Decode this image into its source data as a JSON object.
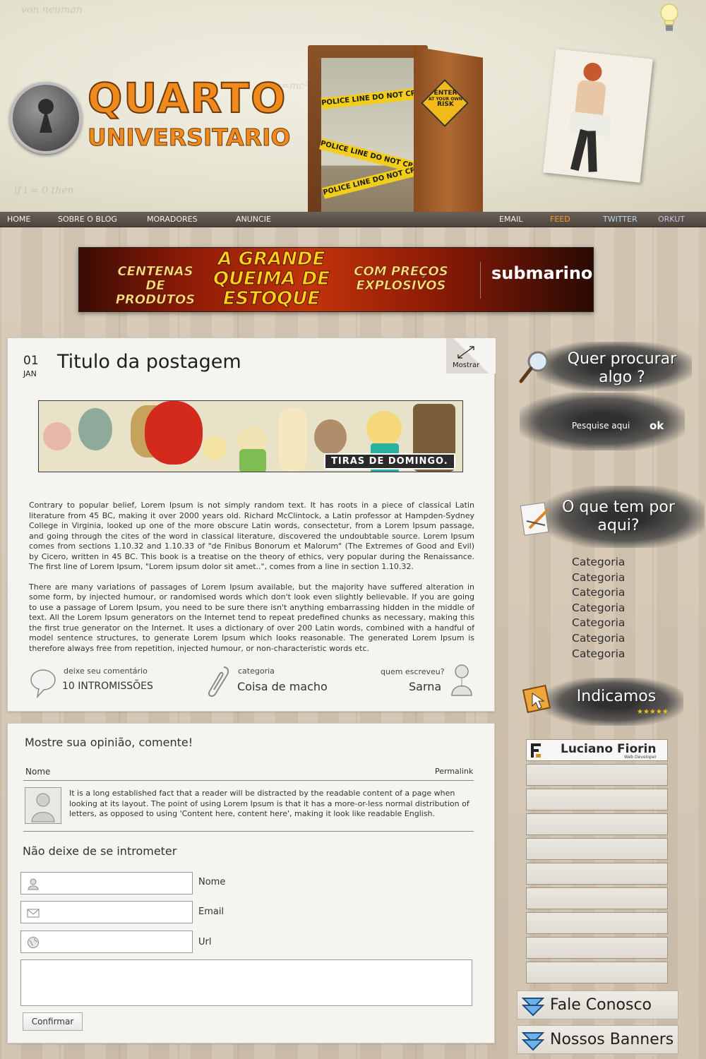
{
  "header": {
    "logo_title": "QUARTO",
    "logo_subtitle": "UNIVERSITARIO",
    "door_sign": [
      "ENTER",
      "AT YOUR OWN",
      "RISK"
    ],
    "tape_text": "POLICE LINE DO NOT CROSS"
  },
  "nav": {
    "left": [
      "HOME",
      "SOBRE O BLOG",
      "MORADORES",
      "ANUNCIE"
    ],
    "right": [
      {
        "label": "EMAIL",
        "color": "#f4f1ea"
      },
      {
        "label": "FEED",
        "color": "#f39a2a"
      },
      {
        "label": "TWITTER",
        "color": "#bcd7ee"
      },
      {
        "label": "ORKUT",
        "color": "#d7b6e6"
      }
    ]
  },
  "banner": {
    "left": "CENTENAS DE PRODUTOS",
    "center": "A GRANDE QUEIMA DE ESTOQUE",
    "right": "COM PREÇOS EXPLOSIVOS",
    "brand": "submarino"
  },
  "post": {
    "day": "01",
    "month": "JAN",
    "title": "Titulo da postagem",
    "toggle_label": "Mostrar",
    "comic_caption": "TIRAS DE DOMINGO.",
    "paragraphs": [
      "Contrary to popular belief, Lorem Ipsum is not simply random text. It has roots in a piece of classical Latin literature from 45 BC, making it over 2000 years old. Richard McClintock, a Latin professor at Hampden-Sydney College in Virginia, looked up one of the more obscure Latin words, consectetur, from a Lorem Ipsum passage, and going through the cites of the word in classical literature, discovered the undoubtable source. Lorem Ipsum comes from sections 1.10.32 and 1.10.33 of \"de Finibus Bonorum et Malorum\" (The Extremes of Good and Evil) by Cicero, written in 45 BC. This book is a treatise on the theory of ethics, very popular during the Renaissance. The first line of Lorem Ipsum, \"Lorem ipsum dolor sit amet..\", comes from a line in section 1.10.32.",
      "There are many variations of passages of Lorem Ipsum available, but the majority have suffered alteration in some form, by injected humour, or randomised words which don't look even slightly believable. If you are going to use a passage of Lorem Ipsum, you need to be sure there isn't anything embarrassing hidden in the middle of text. All the Lorem Ipsum generators on the Internet tend to repeat predefined chunks as necessary, making this the first true generator on the Internet. It uses a dictionary of over 200 Latin words, combined with a handful of model sentence structures, to generate Lorem Ipsum which looks reasonable. The generated Lorem Ipsum is therefore always free from repetition, injected humour, or non-characteristic words etc."
    ],
    "meta": {
      "comment_label": "deixe seu comentário",
      "comment_value": "10 INTROMISSÕES",
      "category_label": "categoria",
      "category_value": "Coisa de macho",
      "author_label": "quem escreveu?",
      "author_value": "Sarna"
    }
  },
  "comments": {
    "heading": "Mostre sua opinião, comente!",
    "name_header": "Nome",
    "permalink": "Permalink",
    "sample_comment": "It is a long established fact that a reader will be distracted by the readable content of a page when looking at its layout. The point of using Lorem Ipsum is that it has a more-or-less normal distribution of letters, as opposed to using 'Content here, content here', making it look like readable English."
  },
  "form": {
    "heading": "Não deixe de se intrometer",
    "name_label": "Nome",
    "email_label": "Email",
    "url_label": "Url",
    "submit": "Confirmar"
  },
  "sidebar": {
    "search_title": "Quer procurar algo ?",
    "search_placeholder": "Pesquise aqui",
    "search_button": "ok",
    "categories_title": "O que tem por aqui?",
    "categories": [
      "Categoria",
      "Categoria",
      "Categoria",
      "Categoria",
      "Categoria",
      "Categoria",
      "Categoria"
    ],
    "recommend_title": "Indicamos",
    "recommend_stars": "★★★★★",
    "partner_name": "Luciano Fiorin",
    "partner_sub": "Web Developer",
    "partner_slots": 9,
    "contact": "Fale Conosco",
    "banners": "Nossos Banners"
  },
  "colors": {
    "logo_orange": "#f08a1c",
    "nav_bg": "#4d463e",
    "card_bg": "#f6f4f0"
  }
}
